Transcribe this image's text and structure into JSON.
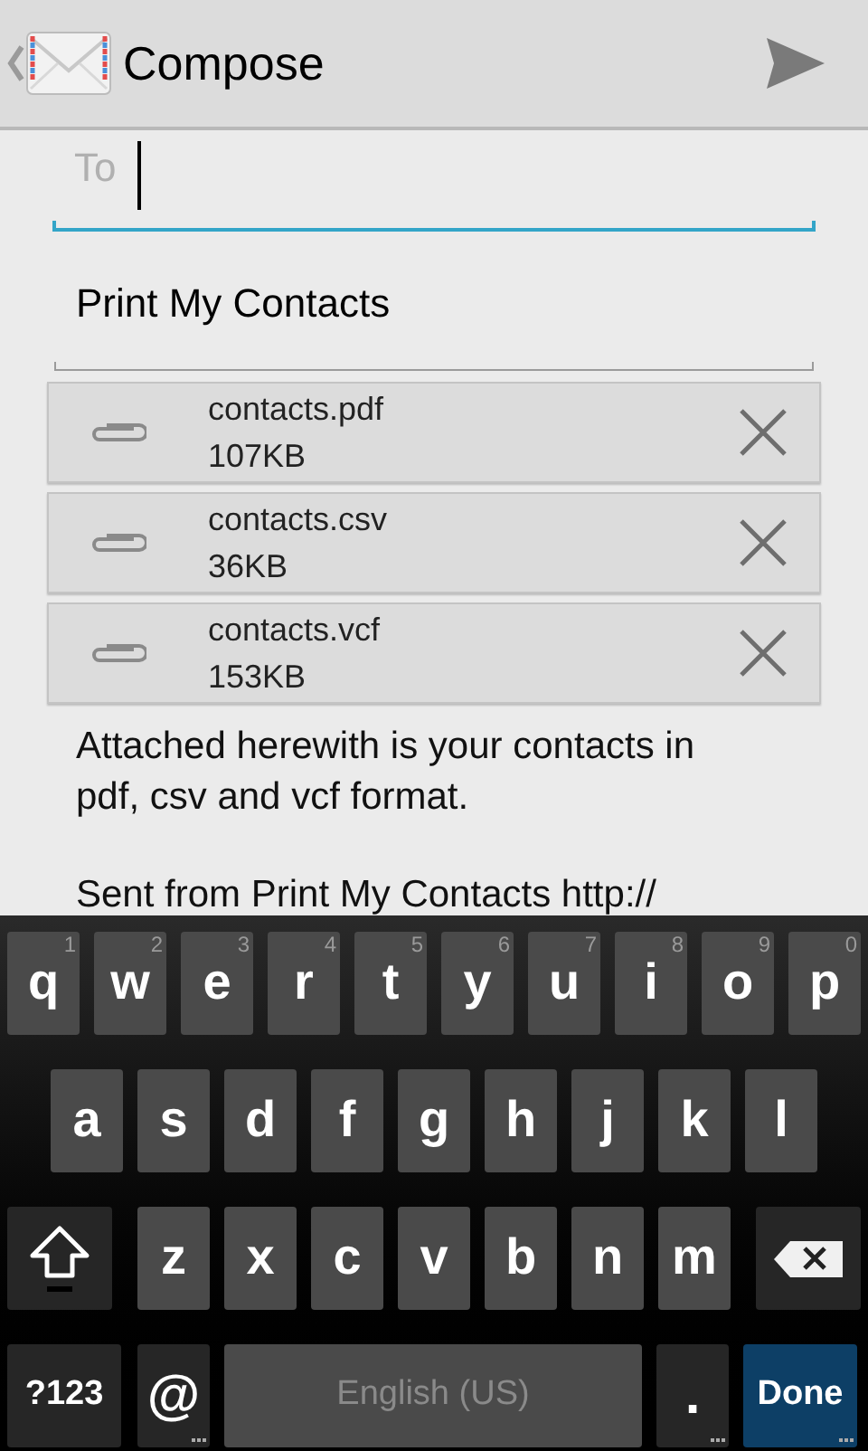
{
  "action_bar": {
    "title": "Compose"
  },
  "to_field": {
    "placeholder": "To"
  },
  "subject_field": {
    "value": "Print My Contacts"
  },
  "attachments": [
    {
      "name": "contacts.pdf",
      "size": "107KB"
    },
    {
      "name": "contacts.csv",
      "size": "36KB"
    },
    {
      "name": "contacts.vcf",
      "size": "153KB"
    }
  ],
  "body": [
    "Attached herewith is your contacts in pdf, csv and vcf format.",
    "Sent from Print My Contacts http://"
  ],
  "keyboard": {
    "rows": [
      {
        "keys": [
          {
            "kind": "letter",
            "label": "q",
            "hint": "1"
          },
          {
            "kind": "letter",
            "label": "w",
            "hint": "2"
          },
          {
            "kind": "letter",
            "label": "e",
            "hint": "3"
          },
          {
            "kind": "letter",
            "label": "r",
            "hint": "4"
          },
          {
            "kind": "letter",
            "label": "t",
            "hint": "5"
          },
          {
            "kind": "letter",
            "label": "y",
            "hint": "6"
          },
          {
            "kind": "letter",
            "label": "u",
            "hint": "7"
          },
          {
            "kind": "letter",
            "label": "i",
            "hint": "8"
          },
          {
            "kind": "letter",
            "label": "o",
            "hint": "9"
          },
          {
            "kind": "letter",
            "label": "p",
            "hint": "0"
          }
        ]
      },
      {
        "keys": [
          {
            "kind": "letter",
            "label": "a"
          },
          {
            "kind": "letter",
            "label": "s"
          },
          {
            "kind": "letter",
            "label": "d"
          },
          {
            "kind": "letter",
            "label": "f"
          },
          {
            "kind": "letter",
            "label": "g"
          },
          {
            "kind": "letter",
            "label": "h"
          },
          {
            "kind": "letter",
            "label": "j"
          },
          {
            "kind": "letter",
            "label": "k"
          },
          {
            "kind": "letter",
            "label": "l"
          }
        ]
      },
      {
        "keys": [
          {
            "kind": "shift"
          },
          {
            "kind": "letter",
            "label": "z"
          },
          {
            "kind": "letter",
            "label": "x"
          },
          {
            "kind": "letter",
            "label": "c"
          },
          {
            "kind": "letter",
            "label": "v"
          },
          {
            "kind": "letter",
            "label": "b"
          },
          {
            "kind": "letter",
            "label": "n"
          },
          {
            "kind": "letter",
            "label": "m"
          },
          {
            "kind": "delete"
          }
        ]
      },
      {
        "keys": [
          {
            "kind": "symbols",
            "label": "?123"
          },
          {
            "kind": "function",
            "label": "@",
            "long_press": true
          },
          {
            "kind": "space",
            "label": "English (US)"
          },
          {
            "kind": "function",
            "label": ".",
            "long_press": true
          },
          {
            "kind": "done",
            "label": "Done",
            "long_press": true
          }
        ]
      }
    ]
  }
}
